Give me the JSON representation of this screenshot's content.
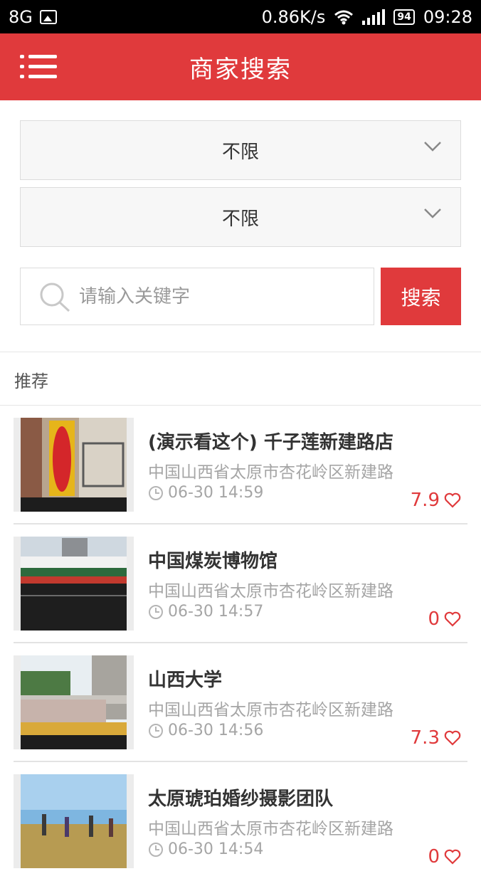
{
  "status_bar": {
    "network": "8G",
    "speed": "0.86K/s",
    "battery": "94",
    "time": "09:28"
  },
  "header": {
    "title": "商家搜索"
  },
  "filters": [
    {
      "value": "不限"
    },
    {
      "value": "不限"
    }
  ],
  "search": {
    "placeholder": "请输入关键字",
    "value": "",
    "button_label": "搜索"
  },
  "section": {
    "title": "推荐"
  },
  "merchants": [
    {
      "title": "(演示看这个) 千子莲新建路店",
      "address": "中国山西省太原市杏花岭区新建路",
      "time": "06-30 14:59",
      "score": "7.9"
    },
    {
      "title": "中国煤炭博物馆",
      "address": "中国山西省太原市杏花岭区新建路",
      "time": "06-30 14:57",
      "score": "0"
    },
    {
      "title": "山西大学",
      "address": "中国山西省太原市杏花岭区新建路",
      "time": "06-30 14:56",
      "score": "7.3"
    },
    {
      "title": "太原琥珀婚纱摄影团队",
      "address": "中国山西省太原市杏花岭区新建路",
      "time": "06-30 14:54",
      "score": "0"
    }
  ],
  "colors": {
    "accent": "#e03a3c",
    "muted_text": "#a5a5a5"
  }
}
